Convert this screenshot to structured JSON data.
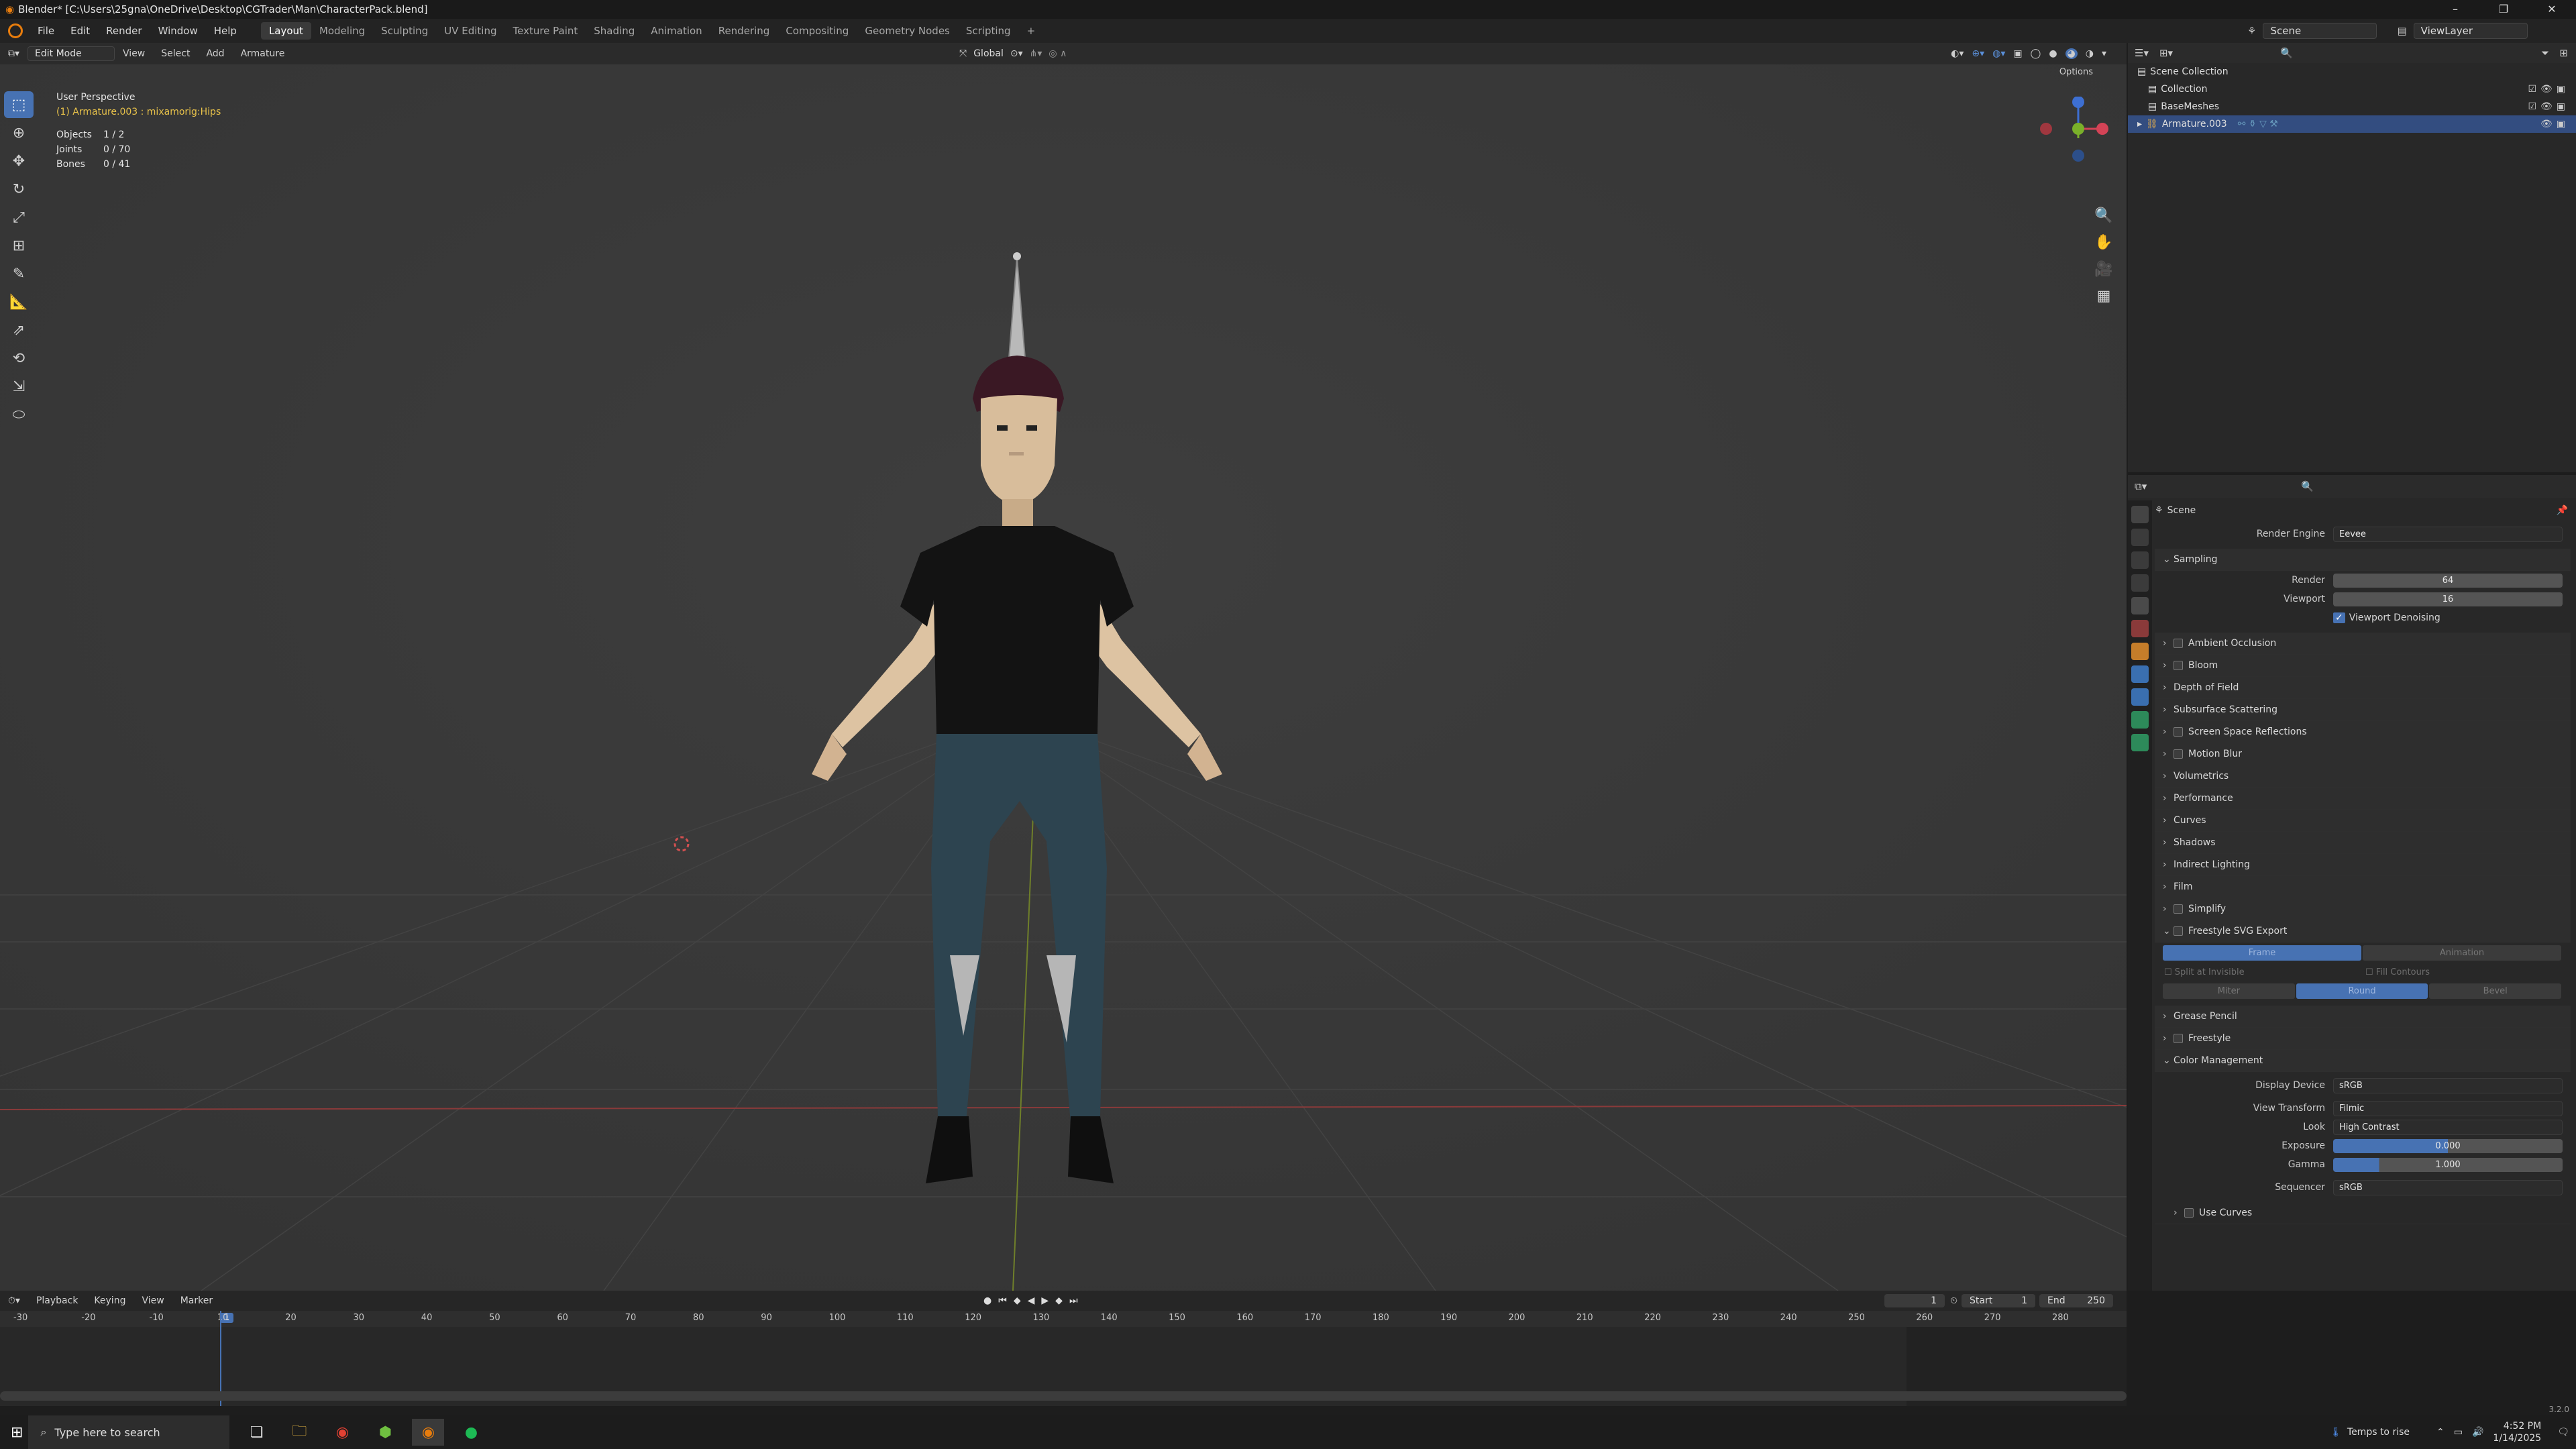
{
  "window": {
    "title": "Blender* [C:\\Users\\25gna\\OneDrive\\Desktop\\CGTrader\\Man\\CharacterPack.blend]",
    "controls": [
      "–",
      "❐",
      "✕"
    ]
  },
  "topbar": {
    "menus": [
      "File",
      "Edit",
      "Render",
      "Window",
      "Help"
    ],
    "workspaces": [
      "Layout",
      "Modeling",
      "Sculpting",
      "UV Editing",
      "Texture Paint",
      "Shading",
      "Animation",
      "Rendering",
      "Compositing",
      "Geometry Nodes",
      "Scripting"
    ],
    "add_workspace": "+",
    "scene": "Scene",
    "view_layer": "ViewLayer"
  },
  "viewport": {
    "mode": "Edit Mode",
    "menus": [
      "View",
      "Select",
      "Add",
      "Armature"
    ],
    "transform_orientation": "Global",
    "options_label": "Options",
    "overlay_title": "User Perspective",
    "overlay_subtitle": "(1) Armature.003 : mixamorig:Hips",
    "stats": [
      {
        "label": "Objects",
        "value": "1 / 2"
      },
      {
        "label": "Joints",
        "value": "0 / 70"
      },
      {
        "label": "Bones",
        "value": "0 / 41"
      }
    ],
    "tools": [
      "select-box",
      "cursor",
      "move",
      "rotate",
      "scale",
      "transform",
      "annotate",
      "measure",
      "extrude",
      "roll",
      "bone-size",
      "envelope"
    ]
  },
  "timeline": {
    "menus": [
      "Playback",
      "Keying",
      "View",
      "Marker"
    ],
    "current_frame": "1",
    "start_label": "Start",
    "start": "1",
    "end_label": "End",
    "end": "250",
    "ruler": [
      "-30",
      "-20",
      "-10",
      "1",
      "10",
      "20",
      "30",
      "40",
      "50",
      "60",
      "70",
      "80",
      "90",
      "100",
      "110",
      "120",
      "130",
      "140",
      "150",
      "160",
      "170",
      "180",
      "190",
      "200",
      "210",
      "220",
      "230",
      "240",
      "250",
      "260",
      "270",
      "280"
    ]
  },
  "outliner": {
    "items": [
      {
        "label": "Scene Collection",
        "indent": 0,
        "selected": false
      },
      {
        "label": "Collection",
        "indent": 1,
        "selected": false
      },
      {
        "label": "BaseMeshes",
        "indent": 1,
        "selected": false
      },
      {
        "label": "Armature.003",
        "indent": 1,
        "selected": true
      }
    ]
  },
  "properties": {
    "context": "Scene",
    "render_engine_label": "Render Engine",
    "render_engine": "Eevee",
    "sampling_title": "Sampling",
    "render_label": "Render",
    "render_samples": "64",
    "viewport_label": "Viewport",
    "viewport_samples": "16",
    "viewport_denoising": "Viewport Denoising",
    "panels": [
      "Ambient Occlusion",
      "Bloom",
      "Depth of Field",
      "Subsurface Scattering",
      "Screen Space Reflections",
      "Motion Blur",
      "Volumetrics",
      "Performance",
      "Curves",
      "Shadows",
      "Indirect Lighting",
      "Film",
      "Simplify",
      "Freestyle SVG Export"
    ],
    "svg_seg1": [
      "Frame",
      "Animation"
    ],
    "svg_opts": [
      "Split at Invisible",
      "Fill Contours"
    ],
    "svg_seg2": [
      "Miter",
      "Round",
      "Bevel"
    ],
    "panels2": [
      "Grease Pencil",
      "Freestyle"
    ],
    "color_mgmt_title": "Color Management",
    "display_device_label": "Display Device",
    "display_device": "sRGB",
    "view_transform_label": "View Transform",
    "view_transform": "Filmic",
    "look_label": "Look",
    "look": "High Contrast",
    "exposure_label": "Exposure",
    "exposure": "0.000",
    "gamma_label": "Gamma",
    "gamma": "1.000",
    "sequencer_label": "Sequencer",
    "sequencer": "sRGB",
    "use_curves": "Use Curves"
  },
  "statusbar": {
    "version": "3.2.0"
  },
  "taskbar": {
    "search_placeholder": "Type here to search",
    "weather": "Temps to rise",
    "time": "4:52 PM",
    "date": "1/14/2025"
  },
  "colors": {
    "accent": "#4772b3",
    "selection": "#334d80",
    "skin": "#d9bfa0",
    "shirt": "#141414",
    "pants": "#2e4550",
    "hair": "#3a1824"
  }
}
